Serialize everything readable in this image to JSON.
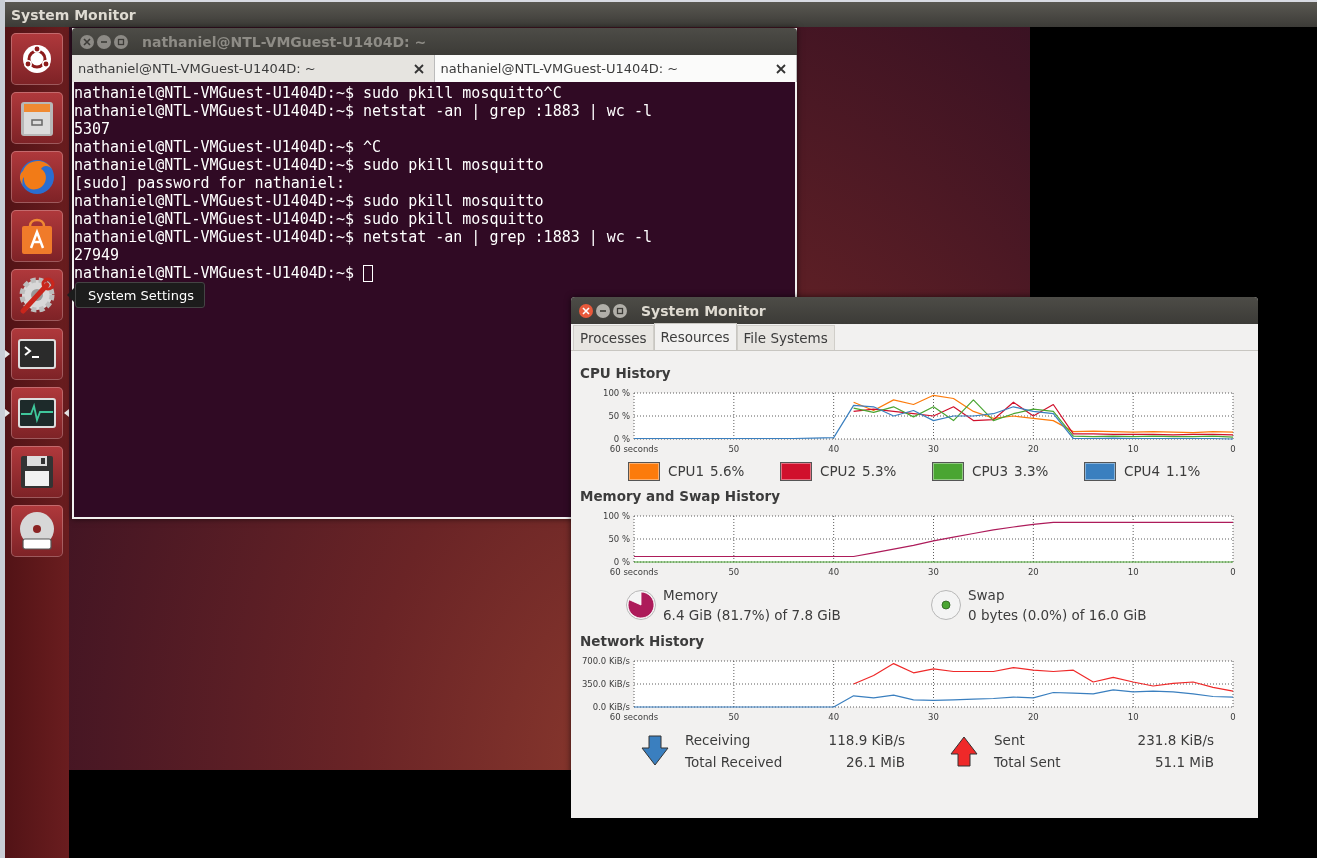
{
  "top_bar": {
    "title": "System Monitor"
  },
  "launcher": [
    {
      "running": false,
      "focused": false
    },
    {
      "running": false,
      "focused": false
    },
    {
      "running": false,
      "focused": false
    },
    {
      "running": false,
      "focused": false
    },
    {
      "running": false,
      "focused": false
    },
    {
      "running": true,
      "focused": false
    },
    {
      "running": true,
      "focused": true
    },
    {
      "running": false,
      "focused": false
    },
    {
      "running": false,
      "focused": false
    }
  ],
  "tooltip": {
    "text": "System Settings"
  },
  "terminal": {
    "title": "nathaniel@NTL-VMGuest-U1404D: ~",
    "focused": false,
    "tabs": [
      {
        "label": "nathaniel@NTL-VMGuest-U1404D: ~",
        "selected": false
      },
      {
        "label": "nathaniel@NTL-VMGuest-U1404D: ~",
        "selected": true
      }
    ],
    "lines": [
      "nathaniel@NTL-VMGuest-U1404D:~$ sudo pkill mosquitto^C",
      "nathaniel@NTL-VMGuest-U1404D:~$ netstat -an | grep :1883 | wc -l",
      "5307",
      "nathaniel@NTL-VMGuest-U1404D:~$ ^C",
      "nathaniel@NTL-VMGuest-U1404D:~$ sudo pkill mosquitto",
      "[sudo] password for nathaniel:",
      "nathaniel@NTL-VMGuest-U1404D:~$ sudo pkill mosquitto",
      "nathaniel@NTL-VMGuest-U1404D:~$ sudo pkill mosquitto",
      "nathaniel@NTL-VMGuest-U1404D:~$ netstat -an | grep :1883 | wc -l",
      "27949",
      "nathaniel@NTL-VMGuest-U1404D:~$ "
    ]
  },
  "system_monitor": {
    "title": "System Monitor",
    "focused": true,
    "tabs": [
      {
        "label": "Processes",
        "selected": false
      },
      {
        "label": "Resources",
        "selected": true
      },
      {
        "label": "File Systems",
        "selected": false
      }
    ],
    "cpu": {
      "title": "CPU History",
      "readings": [
        "5.6%",
        "5.3%",
        "3.3%",
        "1.1%"
      ],
      "chart_data": {
        "type": "line",
        "grid": true,
        "x": [
          60,
          58,
          56,
          54,
          52,
          50,
          48,
          46,
          44,
          42,
          40,
          38,
          36,
          34,
          32,
          30,
          28,
          26,
          24,
          22,
          20,
          18,
          16,
          14,
          12,
          10,
          8,
          6,
          4,
          2,
          0
        ],
        "xlim": [
          60,
          0
        ],
        "ylim": [
          0,
          100
        ],
        "xticks": [
          {
            "value": 60,
            "label": "60 seconds"
          },
          50,
          40,
          30,
          20,
          10,
          0
        ],
        "yticks": [
          {
            "value": 0,
            "label": "0 %"
          },
          {
            "value": 50,
            "label": "50 %"
          },
          {
            "value": 100,
            "label": "100 %"
          }
        ],
        "series": [
          {
            "name": "CPU1",
            "color": "#fc7b0c",
            "values": [
              null,
              null,
              null,
              null,
              null,
              null,
              null,
              null,
              null,
              null,
              null,
              80,
              62,
              85,
              75,
              95,
              88,
              60,
              45,
              50,
              45,
              40,
              16,
              17,
              16,
              15,
              16,
              15,
              14,
              16,
              15
            ]
          },
          {
            "name": "CPU2",
            "color": "#d0102c",
            "values": [
              null,
              null,
              null,
              null,
              null,
              null,
              null,
              null,
              null,
              null,
              null,
              60,
              65,
              60,
              55,
              50,
              70,
              40,
              42,
              80,
              50,
              75,
              11,
              11,
              10,
              10,
              10,
              9,
              10,
              10,
              9
            ]
          },
          {
            "name": "CPU3",
            "color": "#4aa532",
            "values": [
              null,
              null,
              null,
              null,
              null,
              null,
              null,
              null,
              null,
              null,
              null,
              67,
              58,
              70,
              48,
              70,
              40,
              85,
              40,
              55,
              65,
              60,
              6,
              5,
              6,
              5,
              6,
              5,
              5,
              6,
              4
            ]
          },
          {
            "name": "CPU4",
            "color": "#3a7fbf",
            "values": [
              1,
              1,
              1,
              1,
              1,
              1,
              1,
              1,
              1,
              2,
              3,
              73,
              70,
              50,
              62,
              40,
              50,
              50,
              55,
              70,
              60,
              55,
              1,
              1,
              2,
              1,
              1,
              1,
              1,
              1,
              0
            ]
          }
        ]
      }
    },
    "memory": {
      "title": "Memory and Swap History",
      "details": [
        {
          "text": "6.4 GiB (81.7%) of 7.8 GiB",
          "level": 0.817
        },
        {
          "text": "0 bytes (0.0%) of 16.0 GiB"
        }
      ],
      "chart_data": {
        "type": "line",
        "grid": true,
        "x": [
          60,
          58,
          56,
          54,
          52,
          50,
          48,
          46,
          44,
          42,
          40,
          38,
          36,
          34,
          32,
          30,
          28,
          26,
          24,
          22,
          20,
          18,
          16,
          14,
          12,
          10,
          8,
          6,
          4,
          2,
          0
        ],
        "xlim": [
          60,
          0
        ],
        "ylim": [
          0,
          100
        ],
        "xticks": [
          {
            "value": 60,
            "label": "60 seconds"
          },
          50,
          40,
          30,
          20,
          10,
          0
        ],
        "yticks": [
          {
            "value": 0,
            "label": "0 %"
          },
          {
            "value": 50,
            "label": "50 %"
          },
          {
            "value": 100,
            "label": "100 %"
          }
        ],
        "series": [
          {
            "name": "Memory",
            "color": "#ad1b5a",
            "values": [
              12,
              12,
              12,
              12,
              12,
              12,
              12,
              12,
              12,
              12,
              12,
              12,
              20,
              28,
              36,
              46,
              54,
              62,
              70,
              76,
              82,
              86,
              86,
              86,
              86,
              86,
              86,
              86,
              86,
              86,
              86
            ]
          },
          {
            "name": "Swap",
            "color": "#4aa532",
            "values": [
              0,
              0,
              0,
              0,
              0,
              0,
              0,
              0,
              0,
              0,
              0,
              0,
              0,
              0,
              0,
              0,
              0,
              0,
              0,
              0,
              0,
              0,
              0,
              0,
              0,
              0,
              0,
              0,
              0,
              0,
              0
            ]
          }
        ]
      }
    },
    "network": {
      "title": "Network History",
      "stats": [
        {
          "rate": "118.9 KiB/s",
          "total_label": "Total Received",
          "total": "26.1 MiB"
        },
        {
          "rate": "231.8 KiB/s",
          "total_label": "Total Sent",
          "total": "51.1 MiB"
        }
      ],
      "chart_data": {
        "type": "line",
        "grid": true,
        "x": [
          60,
          58,
          56,
          54,
          52,
          50,
          48,
          46,
          44,
          42,
          40,
          38,
          36,
          34,
          32,
          30,
          28,
          26,
          24,
          22,
          20,
          18,
          16,
          14,
          12,
          10,
          8,
          6,
          4,
          2,
          0
        ],
        "xlim": [
          60,
          0
        ],
        "ylim": [
          0,
          700
        ],
        "xticks": [
          {
            "value": 60,
            "label": "60 seconds"
          },
          50,
          40,
          30,
          20,
          10,
          0
        ],
        "yticks": [
          {
            "value": 0,
            "label": "0.0 KiB/s"
          },
          {
            "value": 350,
            "label": "350.0 KiB/s"
          },
          {
            "value": 700,
            "label": "700.0 KiB/s"
          }
        ],
        "series": [
          {
            "name": "Receiving",
            "color": "#3a7fbf",
            "values": [
              0,
              0,
              0,
              0,
              0,
              0,
              0,
              0,
              0,
              0,
              0,
              170,
              140,
              180,
              110,
              100,
              110,
              120,
              130,
              150,
              140,
              220,
              210,
              200,
              260,
              230,
              240,
              230,
              200,
              160,
              150
            ]
          },
          {
            "name": "Sent",
            "color": "#ef2929",
            "values": [
              null,
              null,
              null,
              null,
              null,
              null,
              null,
              null,
              null,
              null,
              null,
              350,
              480,
              660,
              520,
              580,
              540,
              540,
              540,
              600,
              560,
              540,
              560,
              380,
              450,
              380,
              320,
              360,
              380,
              300,
              240
            ]
          }
        ]
      }
    }
  }
}
